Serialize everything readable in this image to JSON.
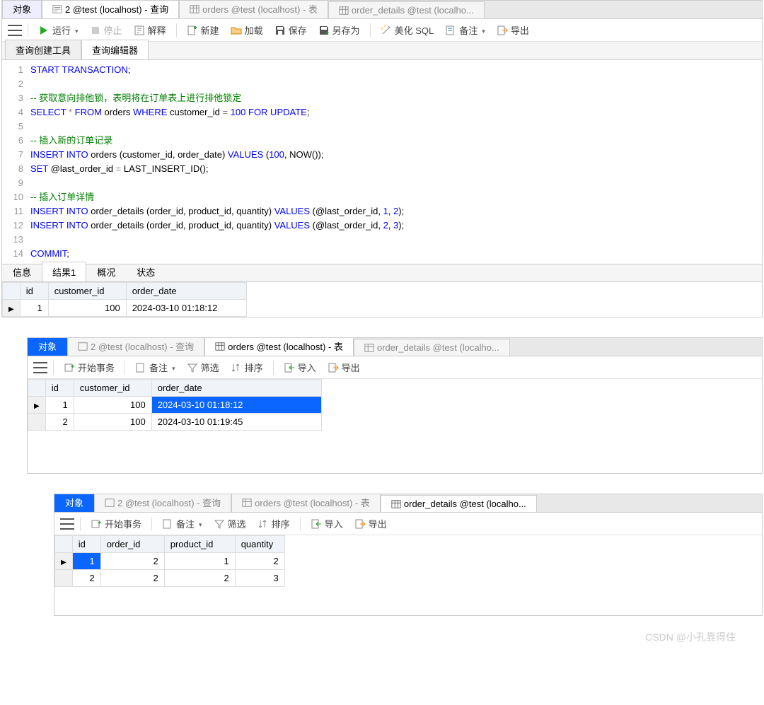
{
  "top_pane": {
    "tabs": [
      {
        "label": "对象",
        "active": true
      },
      {
        "label": "2 @test (localhost) - 查询"
      },
      {
        "label": "orders @test (localhost) - 表"
      },
      {
        "label": "order_details @test (localho..."
      }
    ],
    "toolbar": {
      "run": "运行",
      "stop": "停止",
      "explain": "解释",
      "new": "新建",
      "load": "加载",
      "save": "保存",
      "saveas": "另存为",
      "beautify": "美化 SQL",
      "notes": "备注",
      "export": "导出"
    },
    "subtabs": {
      "builder": "查询创建工具",
      "editor": "查询编辑器"
    },
    "code_lines": [
      {
        "n": 1,
        "t": [
          [
            "kw",
            "START TRANSACTION"
          ],
          [
            "",
            "; "
          ]
        ]
      },
      {
        "n": 2,
        "t": []
      },
      {
        "n": 3,
        "t": [
          [
            "cm",
            "-- 获取意向排他锁，表明将在订单表上进行排他锁定"
          ]
        ]
      },
      {
        "n": 4,
        "t": [
          [
            "kw",
            "SELECT"
          ],
          [
            "",
            " "
          ],
          [
            "op",
            "*"
          ],
          [
            "",
            " "
          ],
          [
            "kw",
            "FROM"
          ],
          [
            "",
            " orders "
          ],
          [
            "kw",
            "WHERE"
          ],
          [
            "",
            " customer_id "
          ],
          [
            "op",
            "="
          ],
          [
            "",
            " "
          ],
          [
            "num",
            "100"
          ],
          [
            "",
            " "
          ],
          [
            "kw",
            "FOR UPDATE"
          ],
          [
            "",
            ";"
          ]
        ]
      },
      {
        "n": 5,
        "t": []
      },
      {
        "n": 6,
        "t": [
          [
            "cm",
            "-- 插入新的订单记录"
          ]
        ]
      },
      {
        "n": 7,
        "t": [
          [
            "kw",
            "INSERT INTO"
          ],
          [
            "",
            " orders (customer_id, order_date) "
          ],
          [
            "kw",
            "VALUES"
          ],
          [
            "",
            " ("
          ],
          [
            "num",
            "100"
          ],
          [
            "",
            ", NOW());"
          ]
        ]
      },
      {
        "n": 8,
        "t": [
          [
            "kw",
            "SET"
          ],
          [
            "",
            " @last_order_id "
          ],
          [
            "op",
            "="
          ],
          [
            "",
            " LAST_INSERT_ID();"
          ]
        ]
      },
      {
        "n": 9,
        "t": []
      },
      {
        "n": 10,
        "t": [
          [
            "cm",
            "-- 插入订单详情"
          ]
        ]
      },
      {
        "n": 11,
        "t": [
          [
            "kw",
            "INSERT INTO"
          ],
          [
            "",
            " order_details (order_id, product_id, quantity) "
          ],
          [
            "kw",
            "VALUES"
          ],
          [
            "",
            " (@last_order_id, "
          ],
          [
            "num",
            "1"
          ],
          [
            "",
            ", "
          ],
          [
            "num",
            "2"
          ],
          [
            "",
            ");"
          ]
        ]
      },
      {
        "n": 12,
        "t": [
          [
            "kw",
            "INSERT INTO"
          ],
          [
            "",
            " order_details (order_id, product_id, quantity) "
          ],
          [
            "kw",
            "VALUES"
          ],
          [
            "",
            " (@last_order_id, "
          ],
          [
            "num",
            "2"
          ],
          [
            "",
            ", "
          ],
          [
            "num",
            "3"
          ],
          [
            "",
            ");"
          ]
        ]
      },
      {
        "n": 13,
        "t": []
      },
      {
        "n": 14,
        "t": [
          [
            "kw",
            "COMMIT"
          ],
          [
            "",
            ";"
          ]
        ]
      }
    ],
    "result_tabs": {
      "info": "信息",
      "r1": "结果1",
      "profile": "概况",
      "status": "状态"
    },
    "result_cols": [
      "id",
      "customer_id",
      "order_date"
    ],
    "result_rows": [
      {
        "id": "1",
        "customer_id": "100",
        "order_date": "2024-03-10 01:18:12",
        "marker": true
      }
    ]
  },
  "mid_pane": {
    "tabs": [
      {
        "label": "对象",
        "blue": true
      },
      {
        "label": "2 @test (localhost) - 查询"
      },
      {
        "label": "orders @test (localhost) - 表",
        "active": true
      },
      {
        "label": "order_details @test (localho..."
      }
    ],
    "toolbar": {
      "begin": "开始事务",
      "notes": "备注",
      "filter": "筛选",
      "sort": "排序",
      "import": "导入",
      "export": "导出"
    },
    "cols": [
      "id",
      "customer_id",
      "order_date"
    ],
    "rows": [
      {
        "id": "1",
        "customer_id": "100",
        "order_date": "2024-03-10 01:18:12",
        "marker": true,
        "selected": true
      },
      {
        "id": "2",
        "customer_id": "100",
        "order_date": "2024-03-10 01:19:45"
      }
    ]
  },
  "bot_pane": {
    "tabs": [
      {
        "label": "对象",
        "blue": true
      },
      {
        "label": "2 @test (localhost) - 查询"
      },
      {
        "label": "orders @test (localhost) - 表"
      },
      {
        "label": "order_details @test (localho...",
        "active": true
      }
    ],
    "toolbar": {
      "begin": "开始事务",
      "notes": "备注",
      "filter": "筛选",
      "sort": "排序",
      "import": "导入",
      "export": "导出"
    },
    "cols": [
      "id",
      "order_id",
      "product_id",
      "quantity"
    ],
    "rows": [
      {
        "id": "1",
        "order_id": "2",
        "product_id": "1",
        "quantity": "2",
        "marker": true,
        "selected": true
      },
      {
        "id": "2",
        "order_id": "2",
        "product_id": "2",
        "quantity": "3"
      }
    ]
  },
  "watermark": "CSDN @小孔靠得住"
}
